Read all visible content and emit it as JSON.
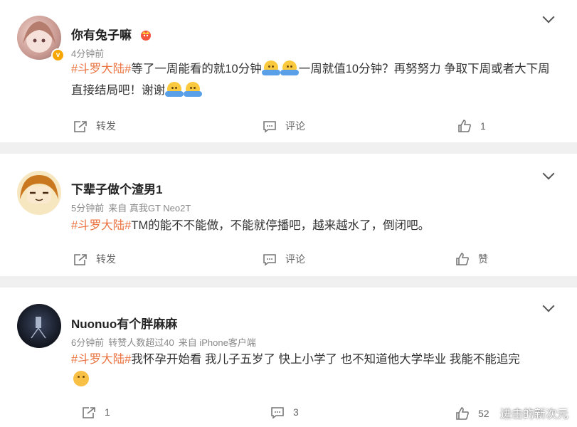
{
  "comments": [
    {
      "username": "你有兔子嘛",
      "meta": [
        "4分钟前"
      ],
      "topic": "#斗罗大陆#",
      "text_a": "等了一周能看的就10分钟",
      "text_b": "一周就值10分钟？再努努力 争取下周或者大下周直接结局吧！谢谢",
      "repost": "转发",
      "comment": "评论",
      "like": "1"
    },
    {
      "username": "下辈子做个渣男1",
      "meta": [
        "5分钟前",
        "来自 真我GT Neo2T"
      ],
      "topic": "#斗罗大陆#",
      "text": "TM的能不不能做，不能就停播吧，越来越水了，倒闭吧。",
      "repost": "转发",
      "comment": "评论",
      "like": "赞"
    },
    {
      "username": "Nuonuo有个胖麻麻",
      "meta": [
        "6分钟前",
        "转赞人数超过40",
        "来自 iPhone客户端"
      ],
      "topic": "#斗罗大陆#",
      "text": "我怀孕开始看 我儿子五岁了 快上小学了 也不知道他大学毕业 我能不能追完",
      "repost": "1",
      "comment": "3",
      "like": "52"
    }
  ],
  "watermark": "进击的新次元",
  "colors": {
    "topic": "#eb7340",
    "background": "#f0f0f0",
    "card": "#ffffff",
    "verified": "#f7a600"
  }
}
